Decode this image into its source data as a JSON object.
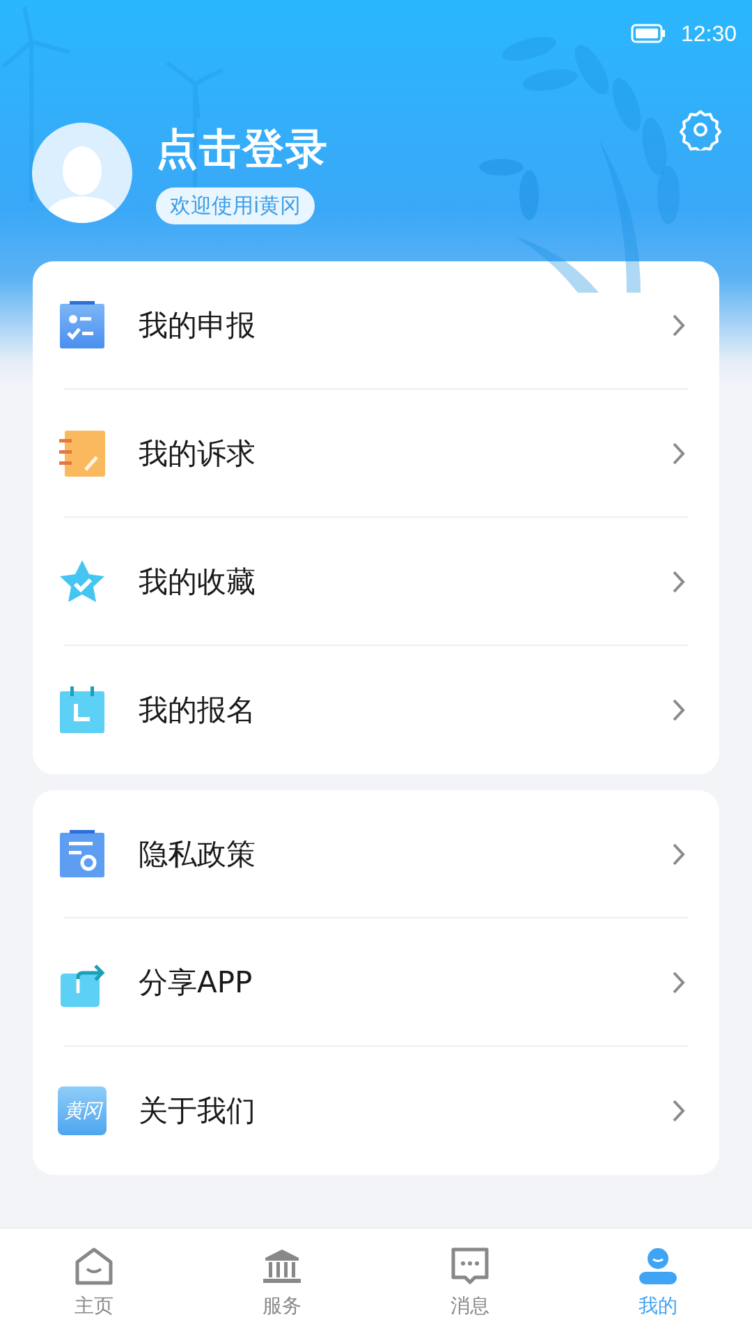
{
  "status_bar": {
    "time": "12:30"
  },
  "profile": {
    "title": "点击登录",
    "subtitle": "欢迎使用i黄冈"
  },
  "menu_groups": [
    {
      "items": [
        {
          "label": "我的申报",
          "kind": "checklist"
        },
        {
          "label": "我的诉求",
          "kind": "notebook"
        },
        {
          "label": "我的收藏",
          "kind": "star"
        },
        {
          "label": "我的报名",
          "kind": "calendar"
        }
      ]
    },
    {
      "items": [
        {
          "label": "隐私政策",
          "kind": "document"
        },
        {
          "label": "分享APP",
          "kind": "share"
        },
        {
          "label": "关于我们",
          "kind": "logo",
          "icon_text": "黄冈"
        }
      ]
    }
  ],
  "nav_tabs": [
    {
      "label": "主页",
      "kind": "home",
      "selected": false
    },
    {
      "label": "服务",
      "kind": "bank",
      "selected": false
    },
    {
      "label": "消息",
      "kind": "message",
      "selected": false
    },
    {
      "label": "我的",
      "kind": "user",
      "selected": true
    }
  ]
}
